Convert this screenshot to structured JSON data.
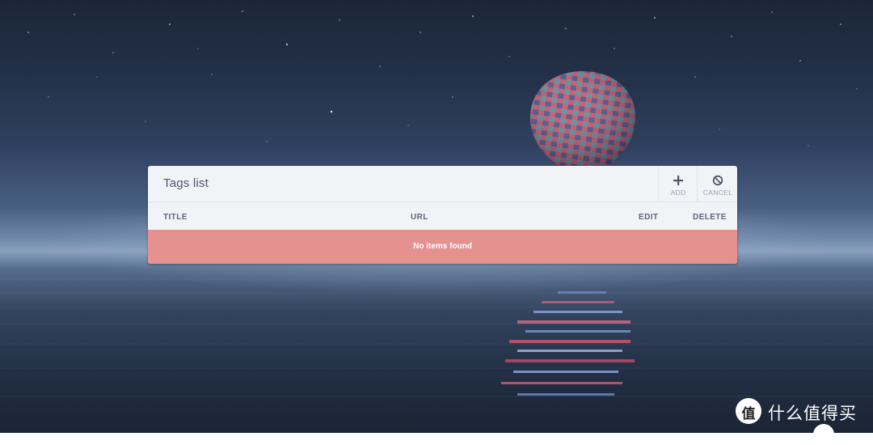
{
  "panel": {
    "title": "Tags list",
    "toolbar": {
      "add_label": "ADD",
      "cancel_label": "CANCEL"
    }
  },
  "table": {
    "columns": [
      "TITLE",
      "URL",
      "EDIT",
      "DELETE"
    ],
    "empty_message": "No items found"
  },
  "watermark": {
    "logo_char": "值",
    "text": "什么值得买"
  },
  "colors": {
    "panel_bg": "#f2f3f7",
    "empty_row_bg": "#e49190",
    "header_text": "#4f5566"
  },
  "icons": {
    "add": "plus-icon",
    "cancel": "ban-icon"
  }
}
